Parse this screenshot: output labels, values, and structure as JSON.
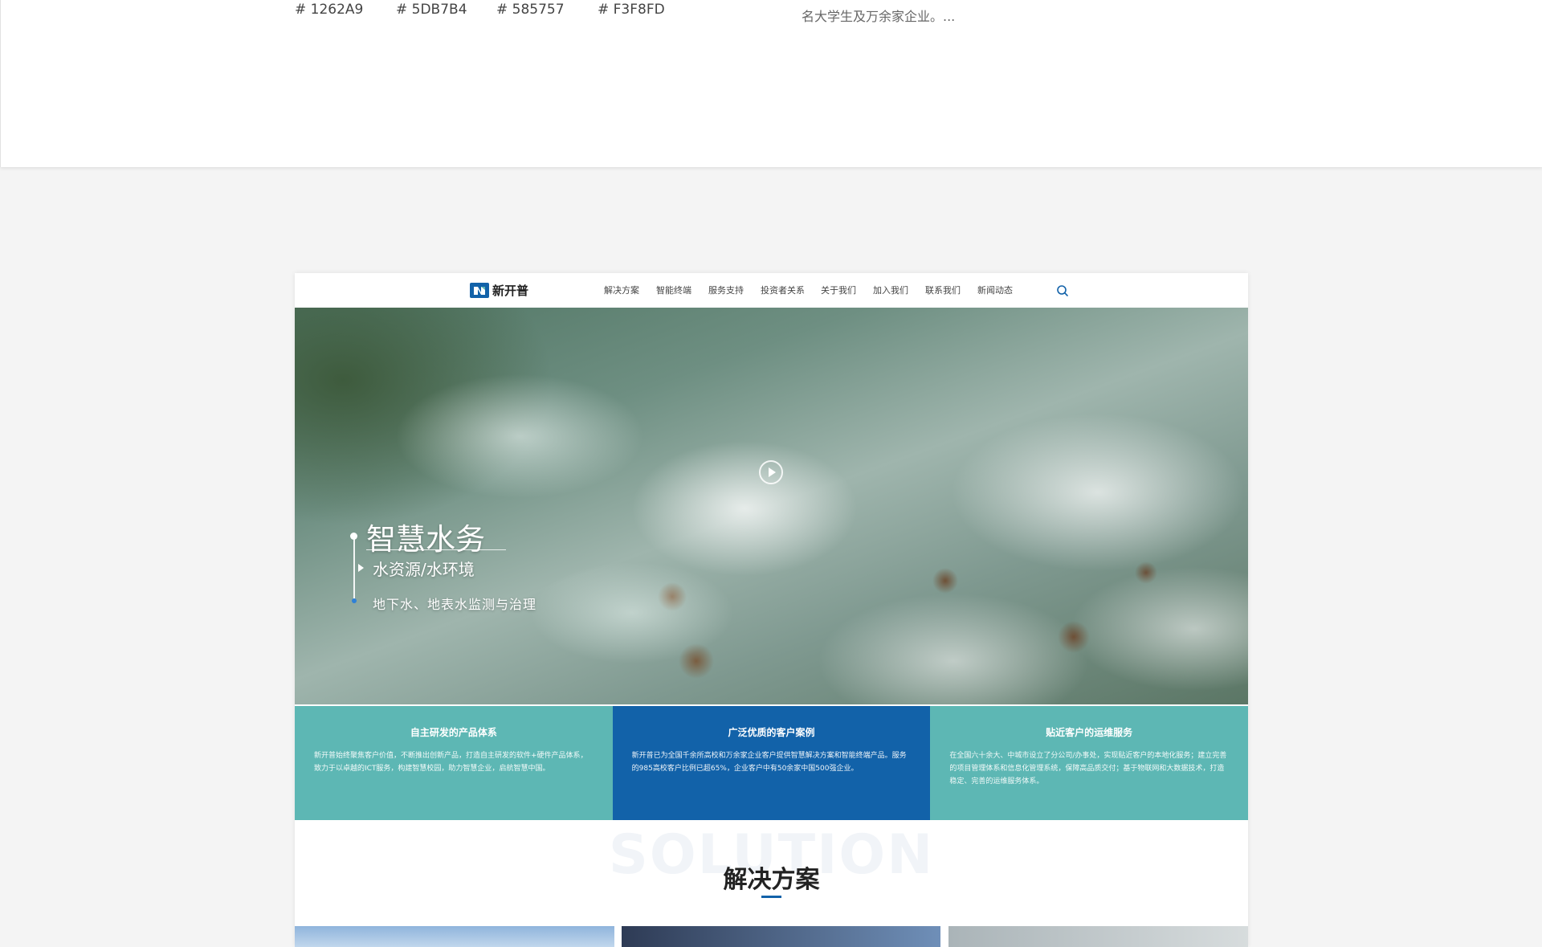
{
  "palette": {
    "swatches": [
      "# 1262A9",
      "# 5DB7B4",
      "# 585757",
      "# F3F8FD"
    ],
    "hex": [
      "#1262A9",
      "#5DB7B4",
      "#585757",
      "#F3F8FD"
    ]
  },
  "top_text": "名大学生及万余家企业。...",
  "site": {
    "logo_text": "新开普",
    "nav": [
      "解决方案",
      "智能终端",
      "服务支持",
      "投资者关系",
      "关于我们",
      "加入我们",
      "联系我们",
      "新闻动态"
    ],
    "hero": {
      "title": "智慧水务",
      "subtitle": "水资源/水环境",
      "description": "地下水、地表水监测与治理"
    },
    "features": [
      {
        "title": "自主研发的产品体系",
        "text": "新开普始终聚焦客户价值，不断推出创新产品，打造自主研发的软件+硬件产品体系，致力于以卓越的ICT服务，构建智慧校园，助力智慧企业，启航智慧中国。",
        "color": "#5DB7B4"
      },
      {
        "title": "广泛优质的客户案例",
        "text": "新开普已为全国千余所高校和万余家企业客户提供智慧解决方案和智能终端产品。服务的985高校客户比例已超65%，企业客户中有50余家中国500强企业。",
        "color": "#1262A9"
      },
      {
        "title": "贴近客户的运维服务",
        "text": "在全国六十余大、中城市设立了分公司/办事处，实现贴近客户的本地化服务；建立完善的项目管理体系和信息化管理系统，保障高品质交付；基于物联网和大数据技术，打造稳定、完善的运维服务体系。",
        "color": "#5DB7B4"
      }
    ],
    "solution": {
      "bg_word": "SOLUTION",
      "title": "解决方案"
    }
  }
}
